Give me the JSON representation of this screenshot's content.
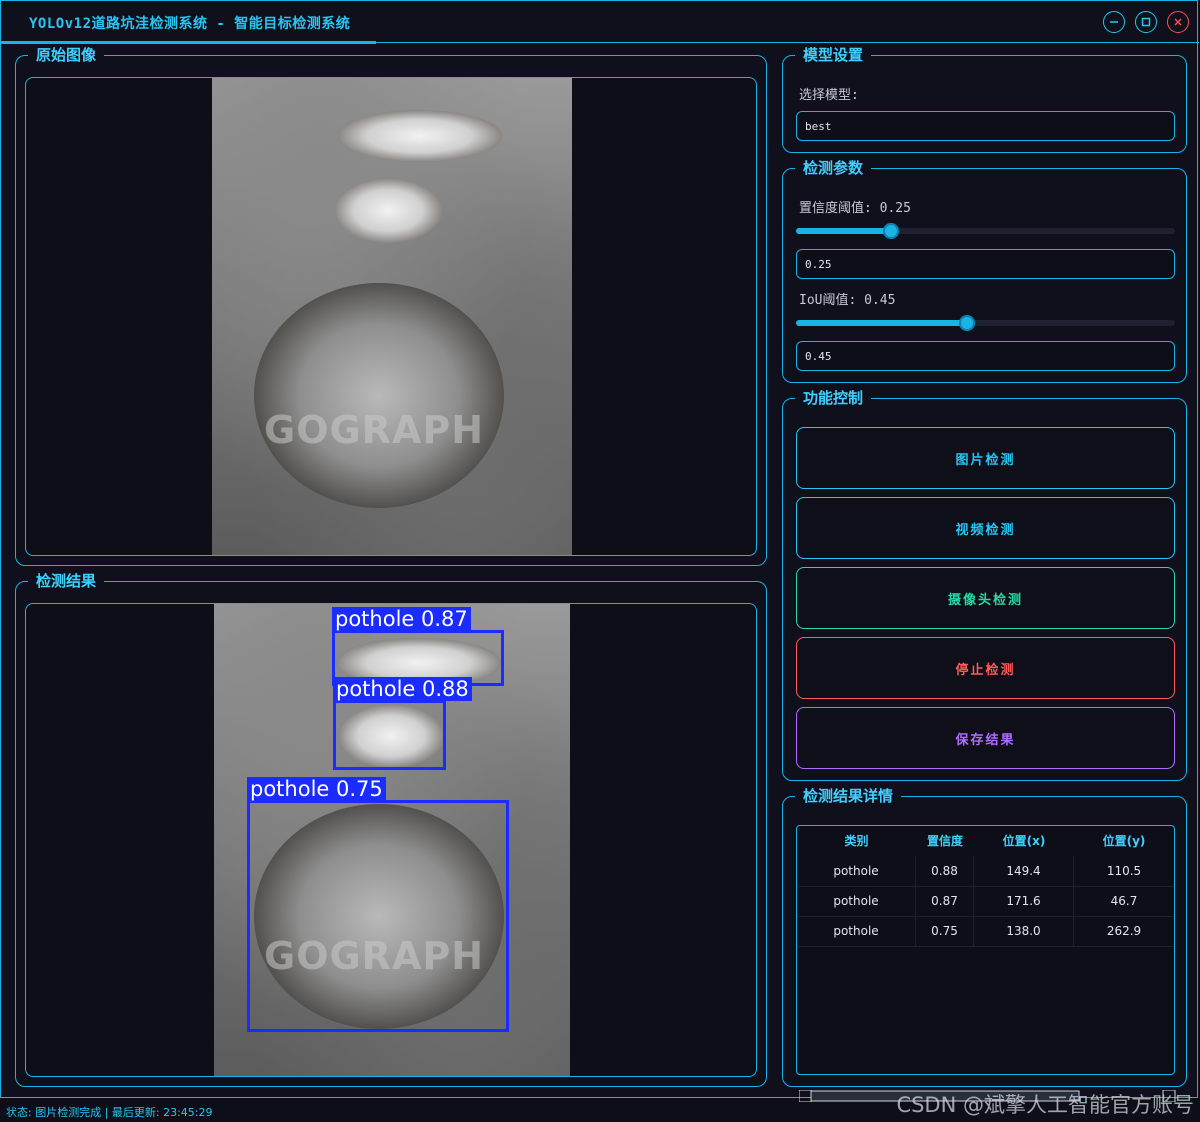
{
  "window": {
    "title": "YOLOv12道路坑洼检测系统 - 智能目标检测系统",
    "controls": [
      "minimize-icon",
      "maximize-icon",
      "close-icon"
    ],
    "accent": "#18b4e6",
    "close_color": "#ff4d4d"
  },
  "original_panel": {
    "title": "原始图像",
    "watermark": "GOGRAPH"
  },
  "result_panel": {
    "title": "检测结果",
    "watermark": "GOGRAPH",
    "box_color": "#1a2cff",
    "detections": [
      {
        "label": "pothole 0.87"
      },
      {
        "label": "pothole 0.88"
      },
      {
        "label": "pothole 0.75"
      }
    ]
  },
  "model_settings": {
    "title": "模型设置",
    "select_label": "选择模型:",
    "model_value": "best"
  },
  "detect_params": {
    "title": "检测参数",
    "conf_label": "置信度阈值: 0.25",
    "conf_value": 0.25,
    "conf_input": "0.25",
    "iou_label": "IoU阈值: 0.45",
    "iou_value": 0.45,
    "iou_input": "0.45"
  },
  "controls": {
    "title": "功能控制",
    "buttons": [
      {
        "label": "图片检测",
        "color": "#27c6f2"
      },
      {
        "label": "视频检测",
        "color": "#27c6f2"
      },
      {
        "label": "摄像头检测",
        "color": "#27d9a8"
      },
      {
        "label": "停止检测",
        "color": "#ff5a5a"
      },
      {
        "label": "保存结果",
        "color": "#b06cff"
      }
    ]
  },
  "details": {
    "title": "检测结果详情",
    "columns": [
      "类别",
      "置信度",
      "位置(x)",
      "位置(y)"
    ],
    "rows": [
      [
        "pothole",
        "0.88",
        "149.4",
        "110.5"
      ],
      [
        "pothole",
        "0.87",
        "171.6",
        "46.7"
      ],
      [
        "pothole",
        "0.75",
        "138.0",
        "262.9"
      ]
    ]
  },
  "status": {
    "text": "状态: 图片检测完成 | 最后更新: 23:45:29"
  },
  "watermark_csdn": "CSDN @斌擎人工智能官方账号"
}
